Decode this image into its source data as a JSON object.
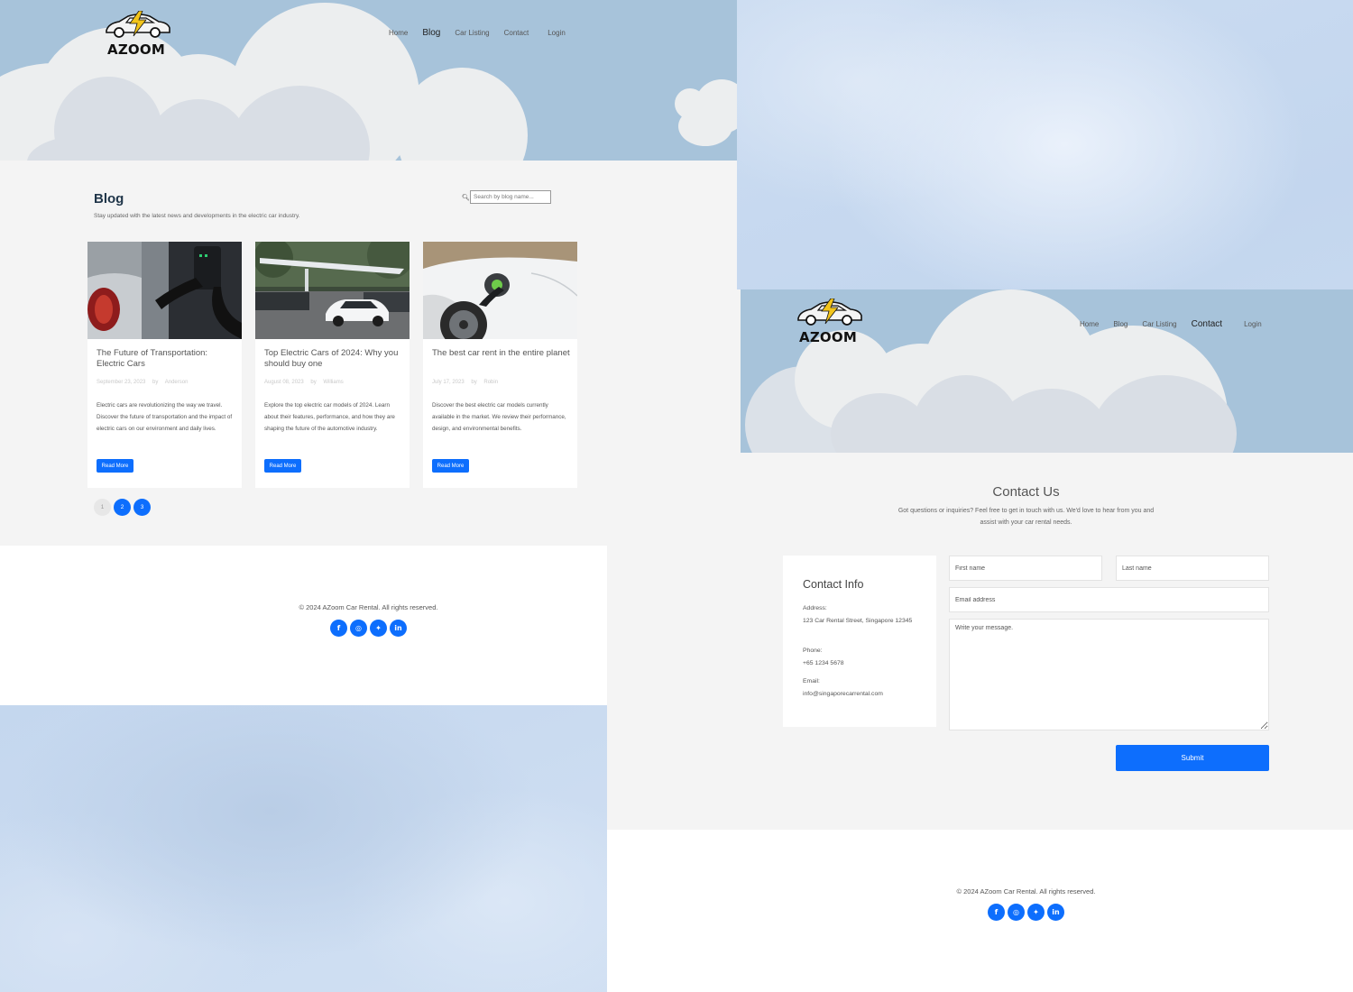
{
  "blog_page": {
    "brand": "AZOOM",
    "nav": [
      "Home",
      "Blog",
      "Car Listing",
      "Contact",
      "Login"
    ],
    "active_nav": "Blog",
    "title": "Blog",
    "subtitle": "Stay updated with the latest news and developments in the electric car industry.",
    "search": {
      "placeholder": "Search by blog name..."
    },
    "cards": [
      {
        "title": "The Future of Transportation: Electric Cars",
        "date": "September 23, 2023",
        "by": "by",
        "author": "Anderson",
        "excerpt": "Electric cars are revolutionizing the way we travel. Discover the future of transportation and the impact of electric cars on our environment and daily lives.",
        "button": "Read More"
      },
      {
        "title": "Top Electric Cars of 2024: Why you should buy one",
        "date": "August 08, 2023",
        "by": "by",
        "author": "Williams",
        "excerpt": "Explore the top electric car models of 2024. Learn about their features, performance, and how they are shaping the future of the automotive industry.",
        "button": "Read More"
      },
      {
        "title": "The best car rent in the entire planet",
        "date": "July 17, 2023",
        "by": "by",
        "author": "Robin",
        "excerpt": "Discover the best electric car models currently available in the market. We review their performance, design, and environmental benefits.",
        "button": "Read More"
      }
    ],
    "pagination": [
      "1",
      "2",
      "3"
    ],
    "current_page": "1",
    "footer": {
      "copyright": "© 2024 AZoom Car Rental. All rights reserved.",
      "socials": [
        {
          "icon": "facebook-icon",
          "glyph": "f"
        },
        {
          "icon": "instagram-icon",
          "glyph": "◎"
        },
        {
          "icon": "twitter-icon",
          "glyph": "🐦"
        },
        {
          "icon": "linkedin-icon",
          "glyph": "in"
        }
      ]
    }
  },
  "contact_page": {
    "brand": "AZOOM",
    "nav": [
      "Home",
      "Blog",
      "Car Listing",
      "Contact",
      "Login"
    ],
    "active_nav": "Contact",
    "title": "Contact Us",
    "intro": "Got questions or inquiries? Feel free to get in touch with us. We'd love to hear from you and assist with your car rental needs.",
    "info": {
      "title": "Contact Info",
      "address_label": "Address:",
      "address": "123 Car Rental Street, Singapore 12345",
      "phone_label": "Phone:",
      "phone": "+65 1234 5678",
      "email_label": "Email:",
      "email": "info@singaporecarrental.com"
    },
    "form": {
      "first_name_placeholder": "First name",
      "last_name_placeholder": "Last name",
      "email_placeholder": "Email address",
      "message_placeholder": "Write your message.",
      "submit": "Submit"
    },
    "footer": {
      "copyright": "© 2024 AZoom Car Rental. All rights reserved."
    }
  },
  "colors": {
    "accent": "#0d6efd",
    "hero_sky": "#a7c3da",
    "cloud_light": "#eceeef",
    "cloud_mid": "#d9dee5",
    "page_bg": "#f4f4f4"
  }
}
